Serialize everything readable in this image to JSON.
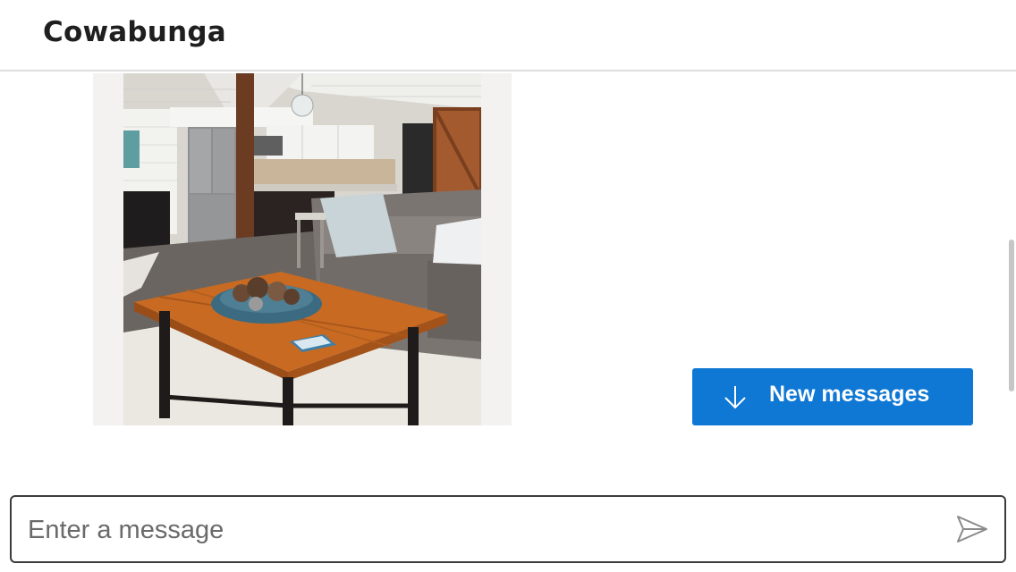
{
  "chat": {
    "title": "Cowabunga"
  },
  "message_area": {
    "image_alt": "Living room with wooden coffee table, grey sofa and kitchen in background",
    "new_messages_label": "New messages",
    "new_messages_icon": "arrow-down-icon"
  },
  "compose": {
    "placeholder": "Enter a message",
    "value": "",
    "send_icon": "send-icon"
  },
  "colors": {
    "accent": "#0f78d4",
    "header_border": "#dedede",
    "compose_border": "#3b3b3b",
    "image_card_bg": "#f3f2f1"
  }
}
